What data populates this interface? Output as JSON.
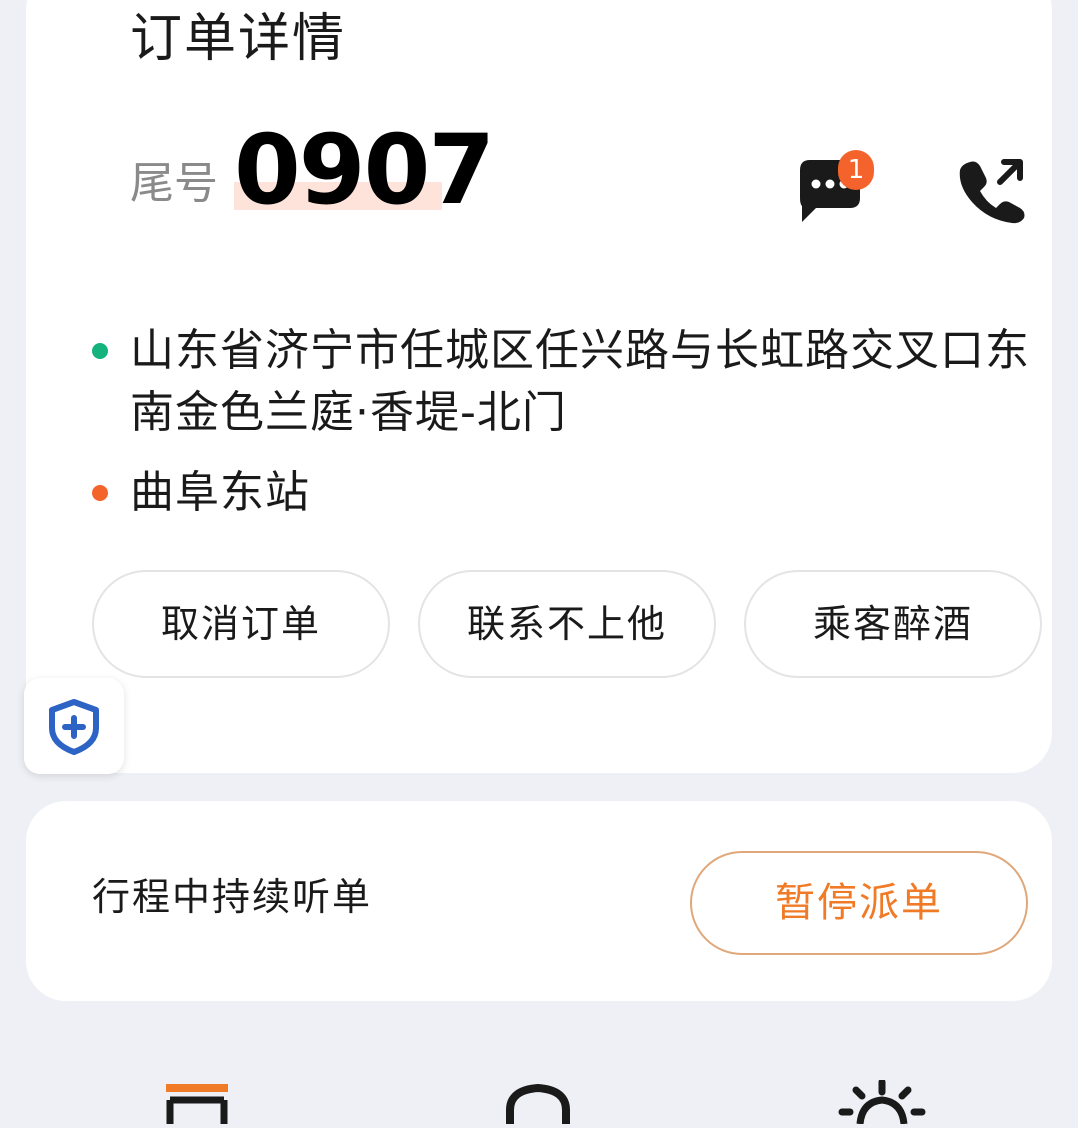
{
  "order": {
    "title": "订单详情",
    "tail_label": "尾号",
    "tail_number": "0907",
    "message_badge": "1",
    "pickup": "山东省济宁市任城区任兴路与长虹路交叉口东南金色兰庭·香堤-北门",
    "dropoff": "曲阜东站",
    "actions": [
      {
        "label": "取消订单"
      },
      {
        "label": "联系不上他"
      },
      {
        "label": "乘客醉酒"
      }
    ]
  },
  "dispatch": {
    "label": "行程中持续听单",
    "pause_label": "暂停派单"
  },
  "icons": {
    "message": "chat-bubble-icon",
    "phone": "phone-outgoing-icon",
    "safety": "shield-plus-icon",
    "tab_order": "order-list-icon",
    "tab_service": "headset-icon",
    "tab_settings": "sun-icon"
  },
  "colors": {
    "pickup_dot": "#14b37d",
    "dropoff_dot": "#f4632b",
    "accent": "#f07a26",
    "badge": "#f4632b",
    "shield": "#2c63c5"
  }
}
